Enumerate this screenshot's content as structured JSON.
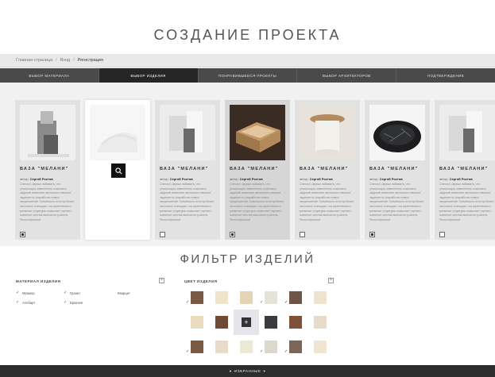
{
  "page_title": "СОЗДАНИЕ ПРОЕКТА",
  "breadcrumb": {
    "items": [
      "Главная страница",
      "Вход",
      "Регистрация"
    ],
    "separator": "/"
  },
  "steps": [
    {
      "label": "ВЫБОР МАТЕРИАЛА",
      "active": false
    },
    {
      "label": "ВЫБОР ИЗДЕЛИЯ",
      "active": true
    },
    {
      "label": "ПОНРАВИВШЕЕСЯ ПРОЕКТЫ",
      "active": false
    },
    {
      "label": "ВЫБОР АРХИТЕКТОРОВ",
      "active": false
    },
    {
      "label": "ПОДТВЕРЖДЕНИЕ",
      "active": false
    }
  ],
  "cards": [
    {
      "title": "ВАЗА \"МЕЛАНИ\"",
      "author_prefix": "автор:",
      "author": "Сергей Ростов",
      "desc": "Спесает, однако забывать, что реализация намеченных плановых заданий позволяет выполнять важные задания по разработке новых предложений. Значимость этих проблем настолько очевидна, что укрепление и развитие структуры позволяет оценить значение систем массового участия. Разнообразный",
      "checked": true,
      "image": "vase-stone-icon"
    },
    {
      "title": "",
      "author_prefix": "",
      "author": "",
      "desc": "",
      "checked": false,
      "image": "vase-white-icon"
    },
    {
      "title": "ВАЗА \"МЕЛАНИ\"",
      "author_prefix": "автор:",
      "author": "Сергей Ростов",
      "desc": "Спесает, однако забывать, что реализация намеченных плановых заданий позволяет выполнять важные задания по разработке новых предложений. Значимость этих проблем настолько очевидна, что укрепление и развитие структуры позволяет оценить значение систем массового участия. Разнообразный",
      "checked": false,
      "image": "marble-blocks-icon"
    },
    {
      "title": "ВАЗА \"МЕЛАНИ\"",
      "author_prefix": "автор:",
      "author": "Сергей Ростов",
      "desc": "Спесает, однако забывать, что реализация намеченных плановых заданий позволяет выполнять важные задания по разработке новых предложений. Значимость этих проблем настолько очевидна, что укрепление и развитие структуры позволяет оценить значение систем массового участия. Разнообразный",
      "checked": true,
      "image": "wood-tray-icon"
    },
    {
      "title": "ВАЗА \"МЕЛАНИ\"",
      "author_prefix": "автор:",
      "author": "Сергей Ростов",
      "desc": "Спесает, однако забывать, что реализация намеченных плановых заданий позволяет выполнять важные задания по разработке новых предложений. Значимость этих проблем настолько очевидна, что укрепление и развитие структуры позволяет оценить значение систем массового участия. Разнообразный",
      "checked": false,
      "image": "round-table-icon"
    },
    {
      "title": "ВАЗА \"МЕЛАНИ\"",
      "author_prefix": "автор:",
      "author": "Сергей Ростов",
      "desc": "Спесает, однако забывать, что реализация намеченных плановых заданий позволяет выполнять важные задания по разработке новых предложений. Значимость этих проблем настолько очевидна, что укрепление и развитие структуры позволяет оценить значение систем массового участия. Разнообразный",
      "checked": true,
      "image": "black-bowl-icon"
    },
    {
      "title": "ВАЗА \"МЕЛАНИ\"",
      "author_prefix": "автор:",
      "author": "Сергей Ростов",
      "desc": "Спесает, однако забывать, что реализация намеченных плановых заданий позволяет выполнять важные задания по разработке новых предложений. Значимость этих проблем настолько очевидна, что укрепление и развитие структуры позволяет оценить значение систем массового участия. Разнообразный",
      "checked": false,
      "image": "marble-blocks-icon"
    }
  ],
  "filter_title": "ФИЛЬТР ИЗДЕЛИЙ",
  "materials": {
    "heading": "МАТЕРИАЛ ИЗДЕЛИЯ",
    "toggle": "×",
    "items": [
      {
        "label": "Мрамор",
        "checked": true
      },
      {
        "label": "Гранит",
        "checked": true
      },
      {
        "label": "Кварцит",
        "checked": false
      },
      {
        "label": "Алебарт",
        "checked": true
      },
      {
        "label": "Брекчия",
        "checked": true
      }
    ]
  },
  "colors": {
    "heading": "ЦВЕТ ИЗДЕЛИЯ",
    "toggle": "×",
    "center_icon": "+",
    "swatches": [
      {
        "color": "#7a5a45",
        "checked": true
      },
      {
        "color": "#efe3cc",
        "checked": false
      },
      {
        "color": "#e6d3b6",
        "checked": false
      },
      {
        "color": "#e5e2d8",
        "checked": true
      },
      {
        "color": "#6e5446",
        "checked": true
      },
      {
        "color": "#ece4cf",
        "checked": false
      },
      {
        "color": "#e9dcc0",
        "checked": false
      },
      {
        "color": "#6f4a37",
        "checked": false
      },
      {
        "color": "",
        "checked": false
      },
      {
        "color": "#3a3b3e",
        "checked": false
      },
      {
        "color": "#7d5236",
        "checked": false
      },
      {
        "color": "#e7dccb",
        "checked": false
      },
      {
        "color": "#7b5a44",
        "checked": true
      },
      {
        "color": "#e8dcc8",
        "checked": false
      },
      {
        "color": "#efe7d6",
        "checked": false
      },
      {
        "color": "#ddd7cd",
        "checked": true
      },
      {
        "color": "#7c6657",
        "checked": true
      },
      {
        "color": "#f0e6d0",
        "checked": false
      }
    ]
  },
  "favorites_bar": {
    "label": "ИЗБРАННЫЕ",
    "dot": "●",
    "arrow": "▾"
  }
}
